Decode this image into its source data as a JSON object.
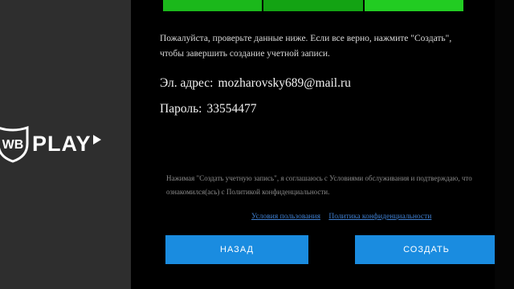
{
  "brand": {
    "play_text": "PLAY",
    "logo_mark": "WB"
  },
  "progress": {
    "value": 1.0,
    "segments": 3,
    "color": "#1bb81b"
  },
  "dialog": {
    "instructions": "Пожалуйста, проверьте данные ниже. Если все верно, нажмите \"Создать\", чтобы завершить создание учетной записи.",
    "email_label": "Эл. адрес:",
    "email_value": "mozharovsky689@mail.ru",
    "password_label": "Пароль:",
    "password_value": "33554477",
    "terms_text": "Нажимая \"Создать учетную запись\", я соглашаюсь с Условиями обслуживания и подтверждаю, что ознакомился(ась) с Политикой конфиденциальности.",
    "link_terms": "Условия пользования",
    "link_privacy": "Политика конфиденциальности",
    "back_button": "НАЗАД",
    "create_button": "СОЗДАТЬ"
  },
  "colors": {
    "accent": "#1a8ce0",
    "progress": "#1bb81b",
    "link": "#3f7fd0"
  }
}
